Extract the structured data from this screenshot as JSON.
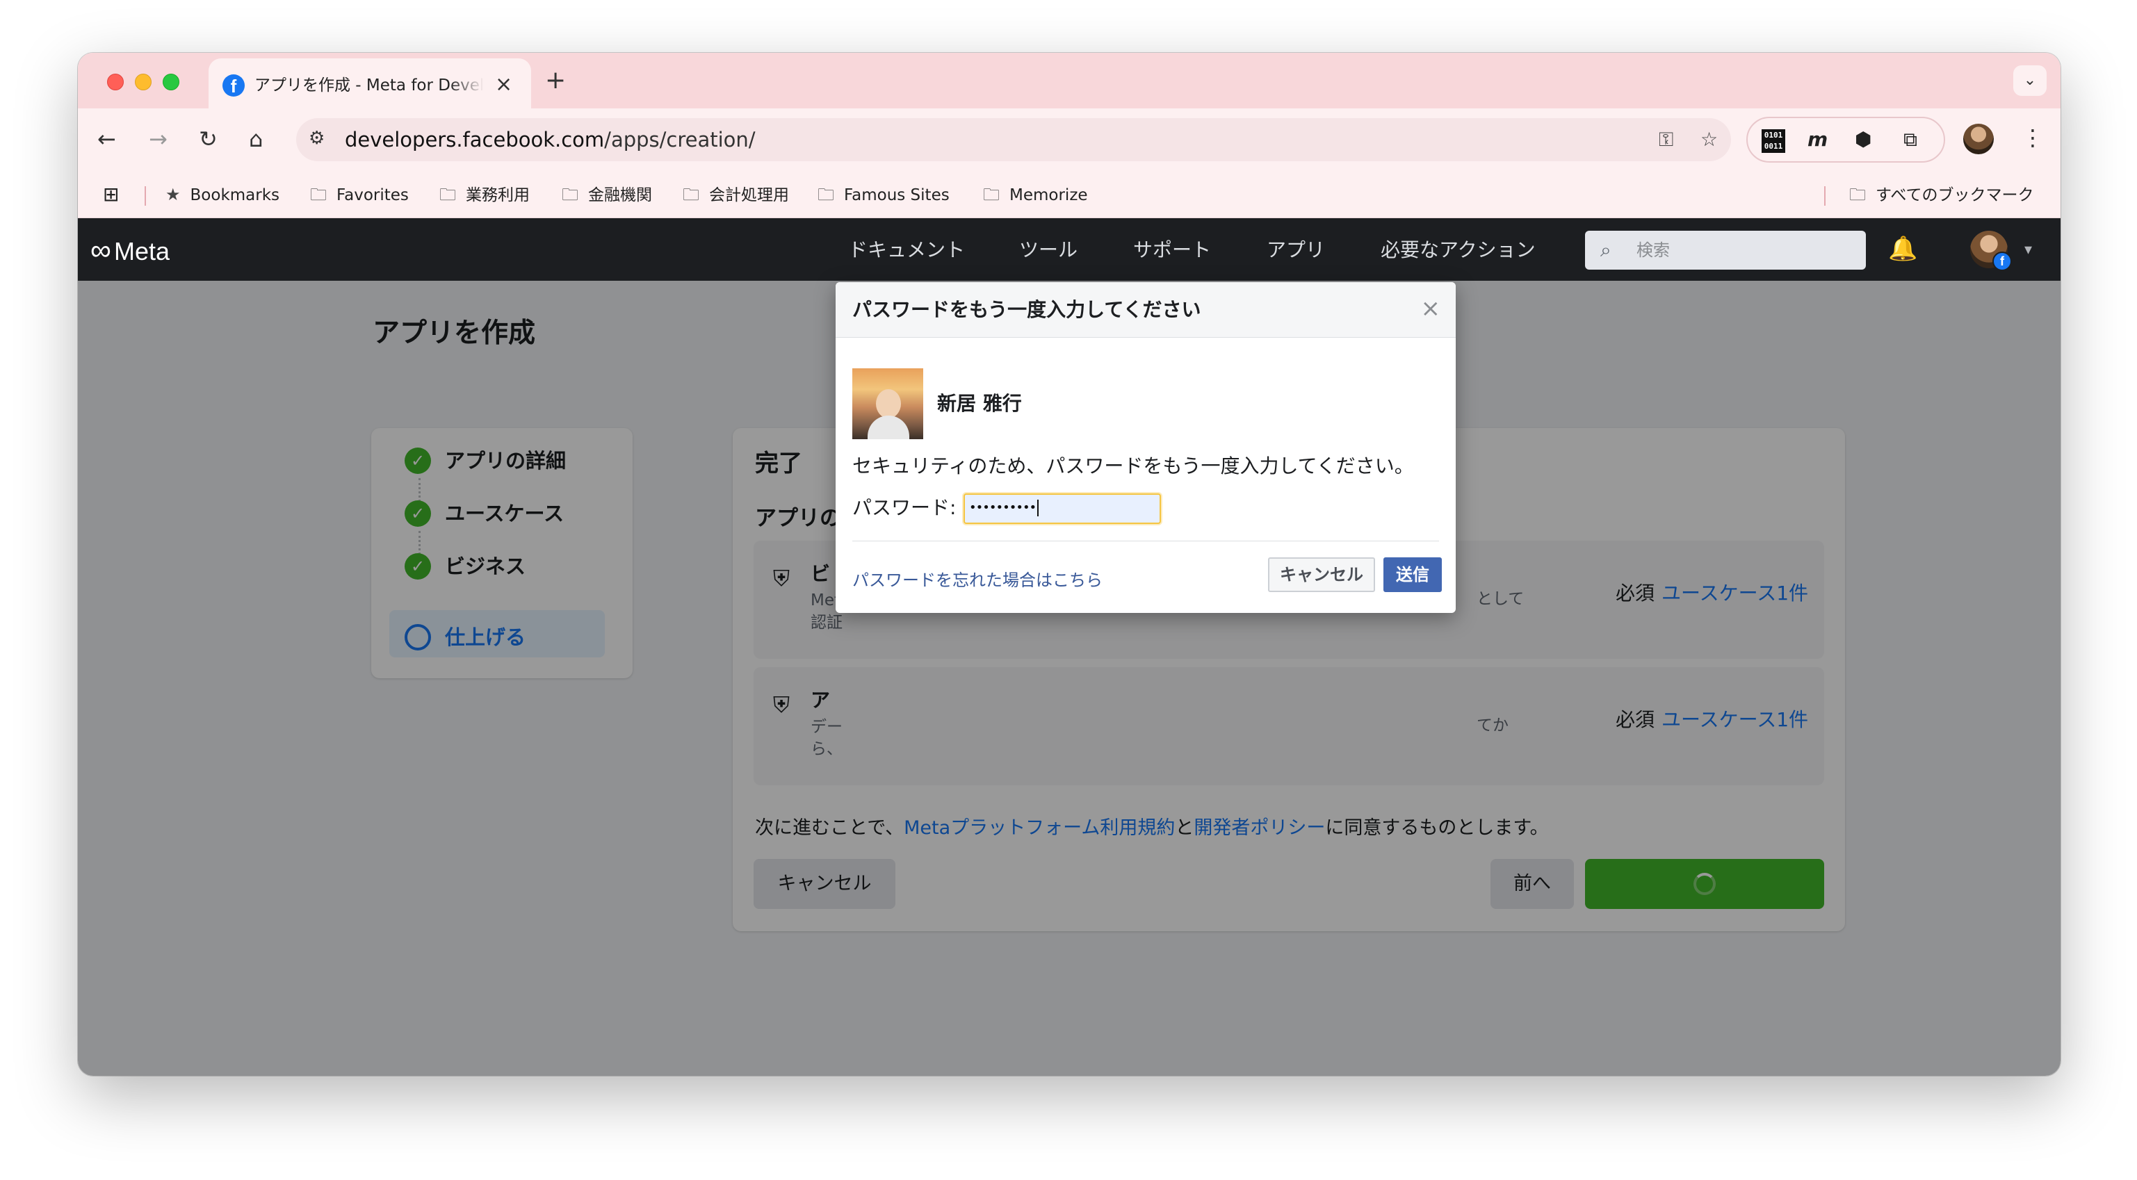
{
  "browser": {
    "tab_title": "アプリを作成 - Meta for Developers",
    "tab_close": "×",
    "new_tab": "+",
    "tab_menu": "⌄",
    "url_host": "developers.facebook.com",
    "url_path": "/apps/creation/",
    "bookmarks": [
      {
        "label": "Bookmarks",
        "icon": "star-icon"
      },
      {
        "label": "Favorites",
        "icon": "folder-icon"
      },
      {
        "label": "業務利用",
        "icon": "folder-icon"
      },
      {
        "label": "金融機関",
        "icon": "folder-icon"
      },
      {
        "label": "会計処理用",
        "icon": "folder-icon"
      },
      {
        "label": "Famous Sites",
        "icon": "folder-icon"
      },
      {
        "label": "Memorize",
        "icon": "folder-icon"
      }
    ],
    "all_bookmarks": "すべてのブックマーク",
    "ext_binary": "0101 0011",
    "ext_m": "m"
  },
  "meta": {
    "logo": "Meta",
    "nav": [
      "ドキュメント",
      "ツール",
      "サポート",
      "アプリ",
      "必要なアクション"
    ],
    "search_placeholder": "検索"
  },
  "page": {
    "title": "アプリを作成",
    "steps": [
      {
        "label": "アプリの詳細",
        "done": true
      },
      {
        "label": "ユースケース",
        "done": true
      },
      {
        "label": "ビジネス",
        "done": true
      },
      {
        "label": "仕上げる",
        "done": false
      }
    ],
    "card_title": "完了",
    "card_subtitle": "アプリの",
    "items": [
      {
        "name": "ビ",
        "desc1": "Met",
        "desc2": "認証",
        "tail": "として",
        "required": "必須",
        "link": "ユースケース1件"
      },
      {
        "name": "ア",
        "desc1": "デー",
        "desc2": "ら、",
        "tail": "てか",
        "required": "必須",
        "link": "ユースケース1件"
      }
    ],
    "legal": {
      "pre": "次に進むことで、",
      "link1": "Metaプラットフォーム利用規約",
      "mid": "と",
      "link2": "開発者ポリシー",
      "post": "に同意するものとします。"
    },
    "cancel": "キャンセル",
    "back": "前へ"
  },
  "dialog": {
    "title": "パスワードをもう一度入力してください",
    "close": "×",
    "user_name": "新居 雅行",
    "message": "セキュリティのため、パスワードをもう一度入力してください。",
    "password_label": "パスワード:",
    "password_value": "••••••••••",
    "forgot_link": "パスワードを忘れた場合はこちら",
    "cancel": "キャンセル",
    "submit": "送信"
  },
  "colors": {
    "tab_strip": "#f8d7da",
    "meta_nav_bg": "#1c1e21",
    "accent": "#1877f2",
    "success": "#42b72a",
    "fb_button": "#4267b2"
  }
}
